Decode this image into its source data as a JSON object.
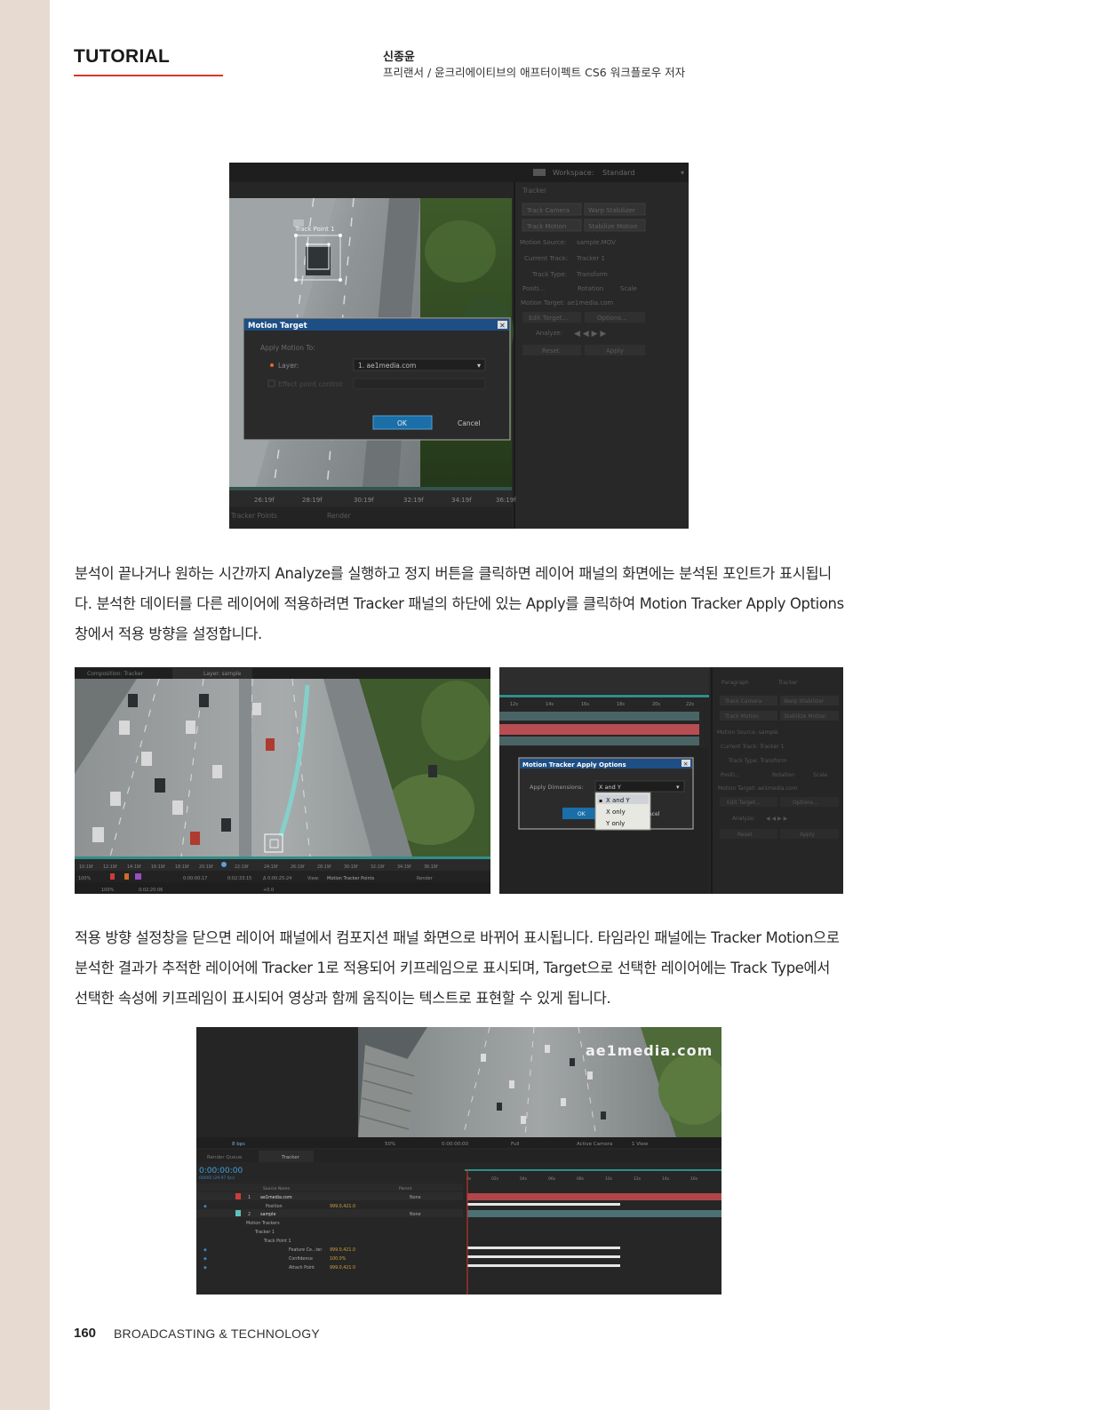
{
  "header": {
    "section": "TUTORIAL",
    "author_name": "신종윤",
    "author_desc": "프리랜서 / 윤크리에이티브의 애프터이펙트 CS6 워크플로우 저자"
  },
  "body": {
    "paragraph_1": "분석이 끝나거나 원하는 시간까지 Analyze를 실행하고 정지 버튼을 클릭하면 레이어 패널의 화면에는 분석된 포인트가 표시됩니다. 분석한 데이터를 다른 레이어에 적용하려면 Tracker 패널의 하단에 있는 Apply를 클릭하여 Motion Tracker Apply Options 창에서 적용 방향을 설정합니다.",
    "paragraph_2": "적용 방향 설정창을 닫으면 레이어 패널에서 컴포지션 패널 화면으로 바뀌어 표시됩니다. 타임라인 패널에는 Tracker Motion으로 분석한 결과가 추적한 레이어에 Tracker 1로 적용되어 키프레임으로 표시되며, Target으로 선택한 레이어에는 Track Type에서 선택한 속성에 키프레임이 표시되어 영상과 함께 움직이는 텍스트로 표현할 수 있게 됩니다."
  },
  "screenshot_1": {
    "workspace_label": "Workspace:",
    "workspace_value": "Standard",
    "tracker_panel": {
      "title": "Tracker",
      "track_camera": "Track Camera",
      "warp_stabilizer": "Warp Stabilizer",
      "track_motion": "Track Motion",
      "stabilize_motion": "Stabilize Motion",
      "motion_source_label": "Motion Source:",
      "motion_source_value": "sample.MOV",
      "current_track_label": "Current Track:",
      "current_track_value": "Tracker 1",
      "track_type_label": "Track Type:",
      "track_type_value": "Transform",
      "position": "Positi...",
      "rotation": "Rotation",
      "scale": "Scale",
      "motion_target": "Motion Target: ae1media.com",
      "edit_target": "Edit Target...",
      "options": "Options...",
      "analyze": "Analyze:",
      "reset": "Reset",
      "apply": "Apply"
    },
    "track_point_label": "Track Point 1",
    "dialog": {
      "title": "Motion Target",
      "apply_to": "Apply Motion To:",
      "layer_label": "Layer:",
      "layer_value": "1. ae1media.com",
      "effect_label": "Effect point control:",
      "ok": "OK",
      "cancel": "Cancel"
    },
    "ruler_ticks": [
      "26:19f",
      "28:19f",
      "30:19f",
      "32:19f",
      "34:19f",
      "36:19f"
    ],
    "bottom_view": "Tracker Points",
    "bottom_render": "Render"
  },
  "screenshot_2": {
    "tab_comp": "Composition: Tracker",
    "tab_layer": "Layer: sample",
    "ruler_ticks": [
      "10:19f",
      "12:19f",
      "14:19f",
      "16:19f",
      "18:19f",
      "20:19f",
      "22:19f",
      "24:19f",
      "26:19f",
      "28:19f",
      "30:19f",
      "32:19f",
      "34:19f",
      "36:19f"
    ],
    "zoom": "100%",
    "timecode_1": "0:00:00:17",
    "timecode_2": "0:02:33:15",
    "timecode_3": "Δ 0:00:25:24",
    "view_label": "View:",
    "view_value": "Motion Tracker Points",
    "render": "Render",
    "footer_zoom": "100%",
    "footer_tc": "0:02:20:06",
    "footer_val": "+0.0"
  },
  "screenshot_3": {
    "ruler_ticks": [
      "12s",
      "14s",
      "16s",
      "18s",
      "20s",
      "22s"
    ],
    "tracker_panel": {
      "tab_paragraph": "Paragraph",
      "tab_tracker": "Tracker",
      "track_camera": "Track Camera",
      "warp_stabilizer": "Warp Stabilizer",
      "track_motion": "Track Motion",
      "stabilize_motion": "Stabilize Motion",
      "motion_source": "Motion Source: sample",
      "current_track": "Current Track: Tracker 1",
      "track_type": "Track Type: Transform",
      "position": "Positi...",
      "rotation": "Rotation",
      "scale": "Scale",
      "motion_target": "Motion Target: ae1media.com",
      "edit_target": "Edit Target...",
      "options": "Options...",
      "analyze": "Analyze:",
      "reset": "Reset",
      "apply": "Apply"
    },
    "dialog": {
      "title": "Motion Tracker Apply Options",
      "dimensions_label": "Apply Dimensions:",
      "dimensions_value": "X and Y",
      "options": [
        "X and Y",
        "X only",
        "Y only"
      ],
      "ok": "OK",
      "cancel": "Cancel"
    }
  },
  "screenshot_4": {
    "watermark": "ae1media.com",
    "comp_toolbar": {
      "zoom": "50%",
      "timecode": "0:00:00:00",
      "resolution": "Full",
      "camera": "Active Camera",
      "view": "1 View"
    },
    "left_toolbar_bpc": "8 bpc",
    "tab_render_queue": "Render Queue",
    "tab_tracker": "Tracker",
    "timecode": "0:00:00:00",
    "fps": "00000 (29.97 fps)",
    "columns": {
      "source_name": "Source Name",
      "parent": "Parent"
    },
    "layers": [
      {
        "num": "1",
        "name": "ae1media.com",
        "parent": "None"
      },
      {
        "num": "",
        "name": "Position",
        "value": "999.0,421.0"
      },
      {
        "num": "2",
        "name": "sample",
        "parent": "None"
      },
      {
        "num": "",
        "name": "Motion Trackers"
      },
      {
        "num": "",
        "name": "Tracker 1"
      },
      {
        "num": "",
        "name": "Track Point 1"
      },
      {
        "num": "",
        "name": "Feature Ce...ter",
        "value": "999.0,421.0"
      },
      {
        "num": "",
        "name": "Confidence",
        "value": "100.0%"
      },
      {
        "num": "",
        "name": "Attach Point",
        "value": "999.0,421.0"
      }
    ],
    "ruler_ticks": [
      "0s",
      "02s",
      "04s",
      "06s",
      "08s",
      "10s",
      "12s",
      "14s",
      "16s"
    ]
  },
  "footer": {
    "page_number": "160",
    "magazine": "BROADCASTING & TECHNOLOGY"
  }
}
